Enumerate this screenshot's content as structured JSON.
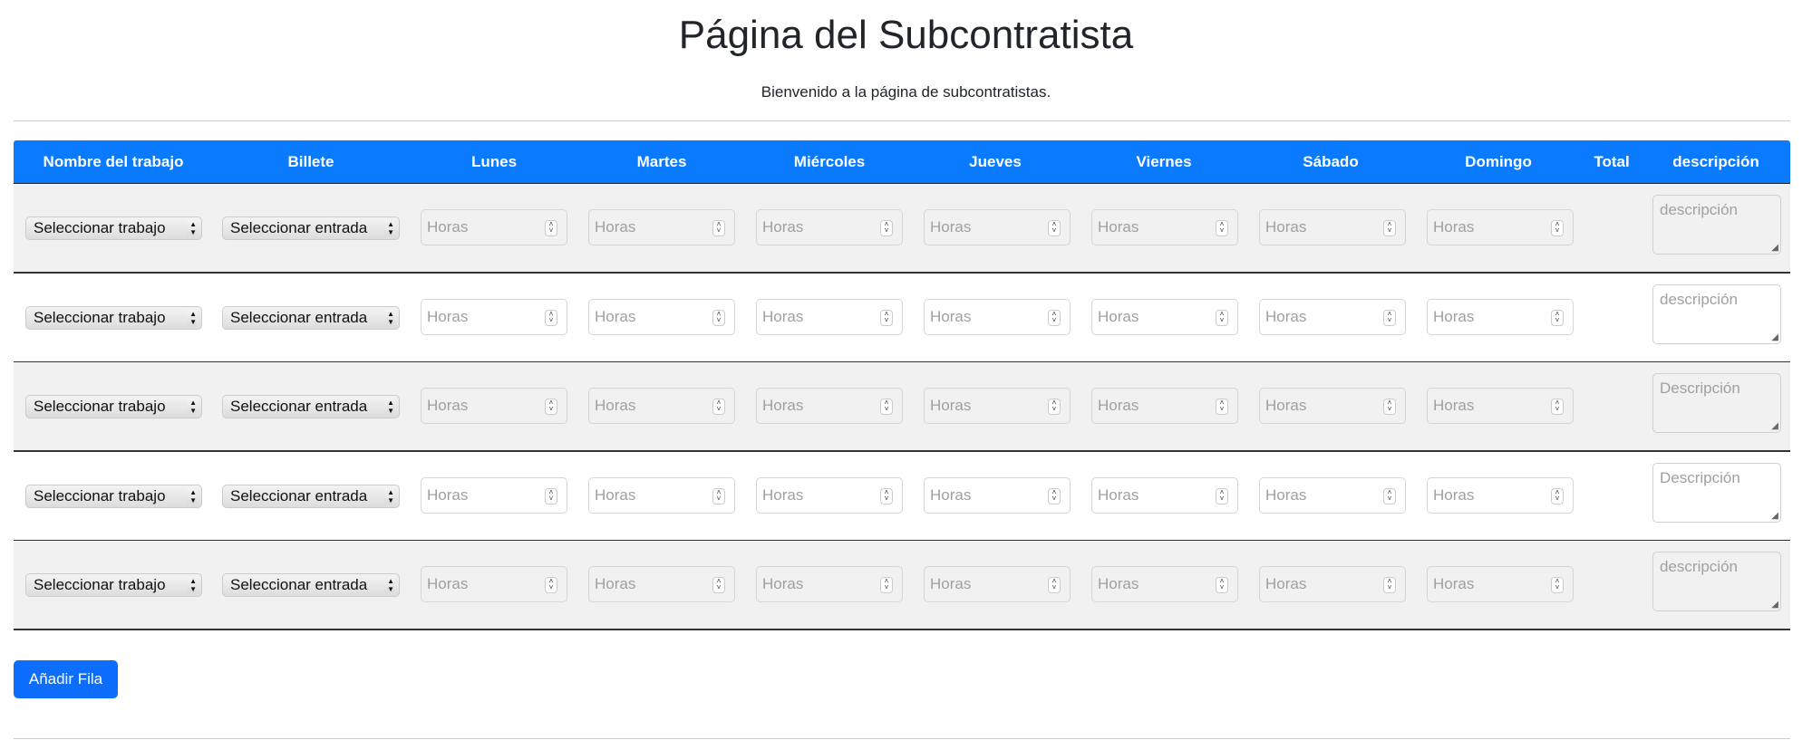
{
  "title": "Página del Subcontratista",
  "subtitle": "Bienvenido a la página de subcontratistas.",
  "columns": [
    "Nombre del trabajo",
    "Billete",
    "Lunes",
    "Martes",
    "Miércoles",
    "Jueves",
    "Viernes",
    "Sábado",
    "Domingo",
    "Total",
    "descripción"
  ],
  "rows": [
    {
      "job": "Seleccionar trabajo",
      "ticket": "Seleccionar entrada",
      "hours_placeholder": "Horas",
      "description_placeholder": "descripción"
    },
    {
      "job": "Seleccionar trabajo",
      "ticket": "Seleccionar entrada",
      "hours_placeholder": "Horas",
      "description_placeholder": "descripción"
    },
    {
      "job": "Seleccionar trabajo",
      "ticket": "Seleccionar entrada",
      "hours_placeholder": "Horas",
      "description_placeholder": "Descripción"
    },
    {
      "job": "Seleccionar trabajo",
      "ticket": "Seleccionar entrada",
      "hours_placeholder": "Horas",
      "description_placeholder": "Descripción"
    },
    {
      "job": "Seleccionar trabajo",
      "ticket": "Seleccionar entrada",
      "hours_placeholder": "Horas",
      "description_placeholder": "descripción"
    }
  ],
  "add_row_label": "Añadir Fila",
  "colors": {
    "header": "#0a7bff",
    "button": "#0d6efd",
    "row_alt": "#f1f1f1"
  }
}
